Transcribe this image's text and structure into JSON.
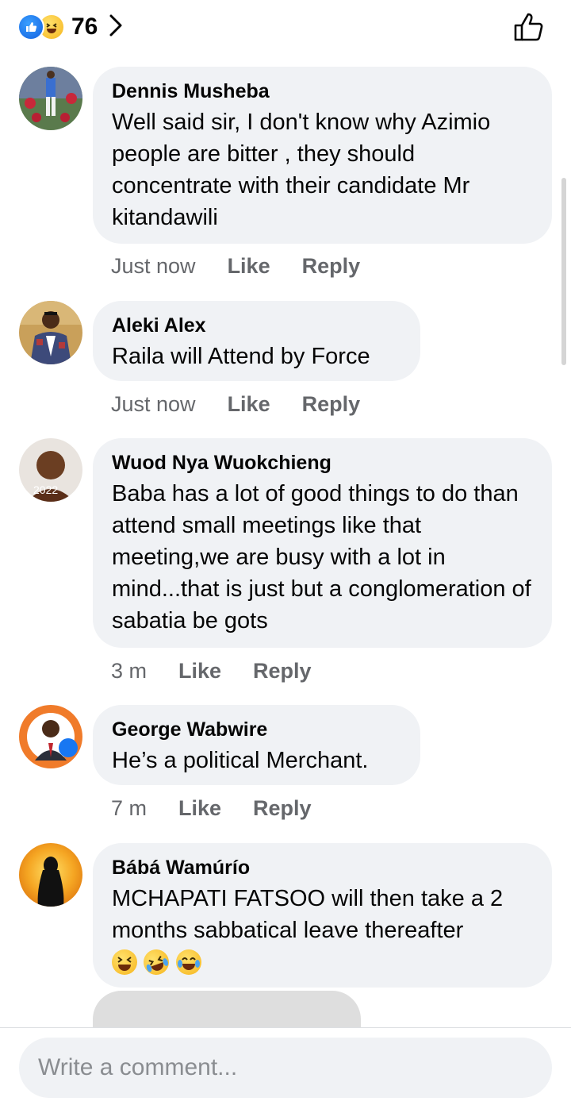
{
  "reactions": {
    "count": "76"
  },
  "comments": [
    {
      "name": "Dennis Musheba",
      "text": "Well said sir, I don't know why Azimio people are bitter , they should concentrate with their candidate Mr kitandawili",
      "time": "Just now",
      "like": "Like",
      "reply": "Reply"
    },
    {
      "name": "Aleki Alex",
      "text": "Raila will Attend by Force",
      "time": "Just now",
      "like": "Like",
      "reply": "Reply"
    },
    {
      "name": "Wuod Nya Wuokchieng",
      "text": "Baba has a lot of good things to do than attend small meetings like that meeting,we are busy with a lot in mind...that is just but a conglomeration of sabatia be gots",
      "time": "3 m",
      "like": "Like",
      "reply": "Reply"
    },
    {
      "name": "George Wabwire",
      "text": "He’s a political Merchant.",
      "time": "7 m",
      "like": "Like",
      "reply": "Reply"
    },
    {
      "name": "Bábá Wamúrío",
      "text": "MCHAPATI FATSOO will then take a 2 months sabbatical leave thereafter"
    }
  ],
  "composer": {
    "placeholder": "Write a comment..."
  },
  "icons": {
    "like_reaction": "like-reaction-icon",
    "haha_reaction": "haha-reaction-icon",
    "chevron": "chevron-right-icon",
    "thumbs_up": "thumbs-up-outline-icon",
    "emojis": [
      "grinning-squint-icon",
      "rolling-laughing-icon",
      "tears-of-joy-icon"
    ]
  },
  "colors": {
    "bubble": "#f0f2f5",
    "meta_text": "#65676b",
    "like_blue": "#1877f2"
  }
}
